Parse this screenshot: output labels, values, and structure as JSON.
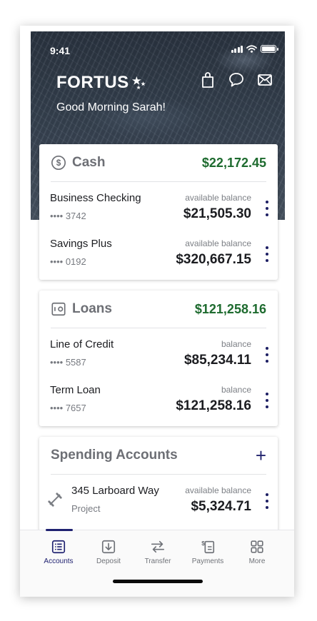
{
  "status": {
    "time": "9:41"
  },
  "header": {
    "brand": "FORTUS",
    "greeting": "Good Morning Sarah!"
  },
  "icons": {
    "bag": "shopping-bag-icon",
    "chat": "chat-bubble-icon",
    "mail": "mail-icon"
  },
  "colors": {
    "accent": "#1f2170",
    "positive": "#1e6b2f",
    "hero": "#333e4b"
  },
  "cash": {
    "title": "Cash",
    "total": "$22,172.45",
    "accounts": [
      {
        "name": "Business Checking",
        "number": "•••• 3742",
        "label": "available balance",
        "balance": "$21,505.30"
      },
      {
        "name": "Savings Plus",
        "number": "•••• 0192",
        "label": "available balance",
        "balance": "$320,667.15"
      }
    ]
  },
  "loans": {
    "title": "Loans",
    "total": "$121,258.16",
    "accounts": [
      {
        "name": "Line of Credit",
        "number": "•••• 5587",
        "label": "balance",
        "balance": "$85,234.11"
      },
      {
        "name": "Term Loan",
        "number": "•••• 7657",
        "label": "balance",
        "balance": "$121,258.16"
      }
    ]
  },
  "spending": {
    "title": "Spending Accounts",
    "add": "+",
    "accounts": [
      {
        "name": "345 Larboard Way",
        "subtitle": "Project",
        "label": "available balance",
        "balance": "$5,324.71"
      }
    ]
  },
  "tabs": [
    {
      "label": "Accounts",
      "icon": "list-icon",
      "active": true
    },
    {
      "label": "Deposit",
      "icon": "deposit-icon",
      "active": false
    },
    {
      "label": "Transfer",
      "icon": "transfer-icon",
      "active": false
    },
    {
      "label": "Payments",
      "icon": "payments-icon",
      "active": false
    },
    {
      "label": "More",
      "icon": "grid-icon",
      "active": false
    }
  ]
}
